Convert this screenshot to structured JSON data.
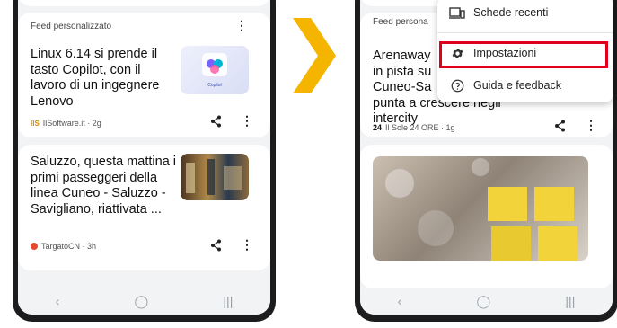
{
  "left_screen": {
    "feed_label": "Feed personalizzato",
    "article1": {
      "title": "Linux 6.14 si prende il tasto Copilot, con il lavoro di un ingegnere Lenovo",
      "source_logo": "IIS",
      "source": "IlSoftware.it · 2g",
      "thumb_label": "Copilot"
    },
    "article2": {
      "title": "Saluzzo, questa mattina i primi passeggeri della linea Cuneo - Saluzzo - Savigliano, riattivata ...",
      "source": "TargatoCN · 3h"
    }
  },
  "right_screen": {
    "feed_label": "Feed persona",
    "article1": {
      "title_lines": [
        "Arenaway",
        "in pista su",
        "Cuneo-Sa",
        "punta a crescere negli",
        "intercity"
      ],
      "source_logo": "24",
      "source": "Il Sole 24 ORE · 1g"
    },
    "menu": {
      "items": [
        {
          "label": "Schede recenti",
          "icon": "recent-tabs-icon"
        },
        {
          "label": "Impostazioni",
          "icon": "gear-icon"
        },
        {
          "label": "Guida e feedback",
          "icon": "help-icon"
        }
      ]
    }
  },
  "colors": {
    "accent_chevron": "#f5b400",
    "highlight": "#e0001b",
    "phone_frame": "#1c1c1e",
    "screen_bg": "#f1f3f4"
  }
}
